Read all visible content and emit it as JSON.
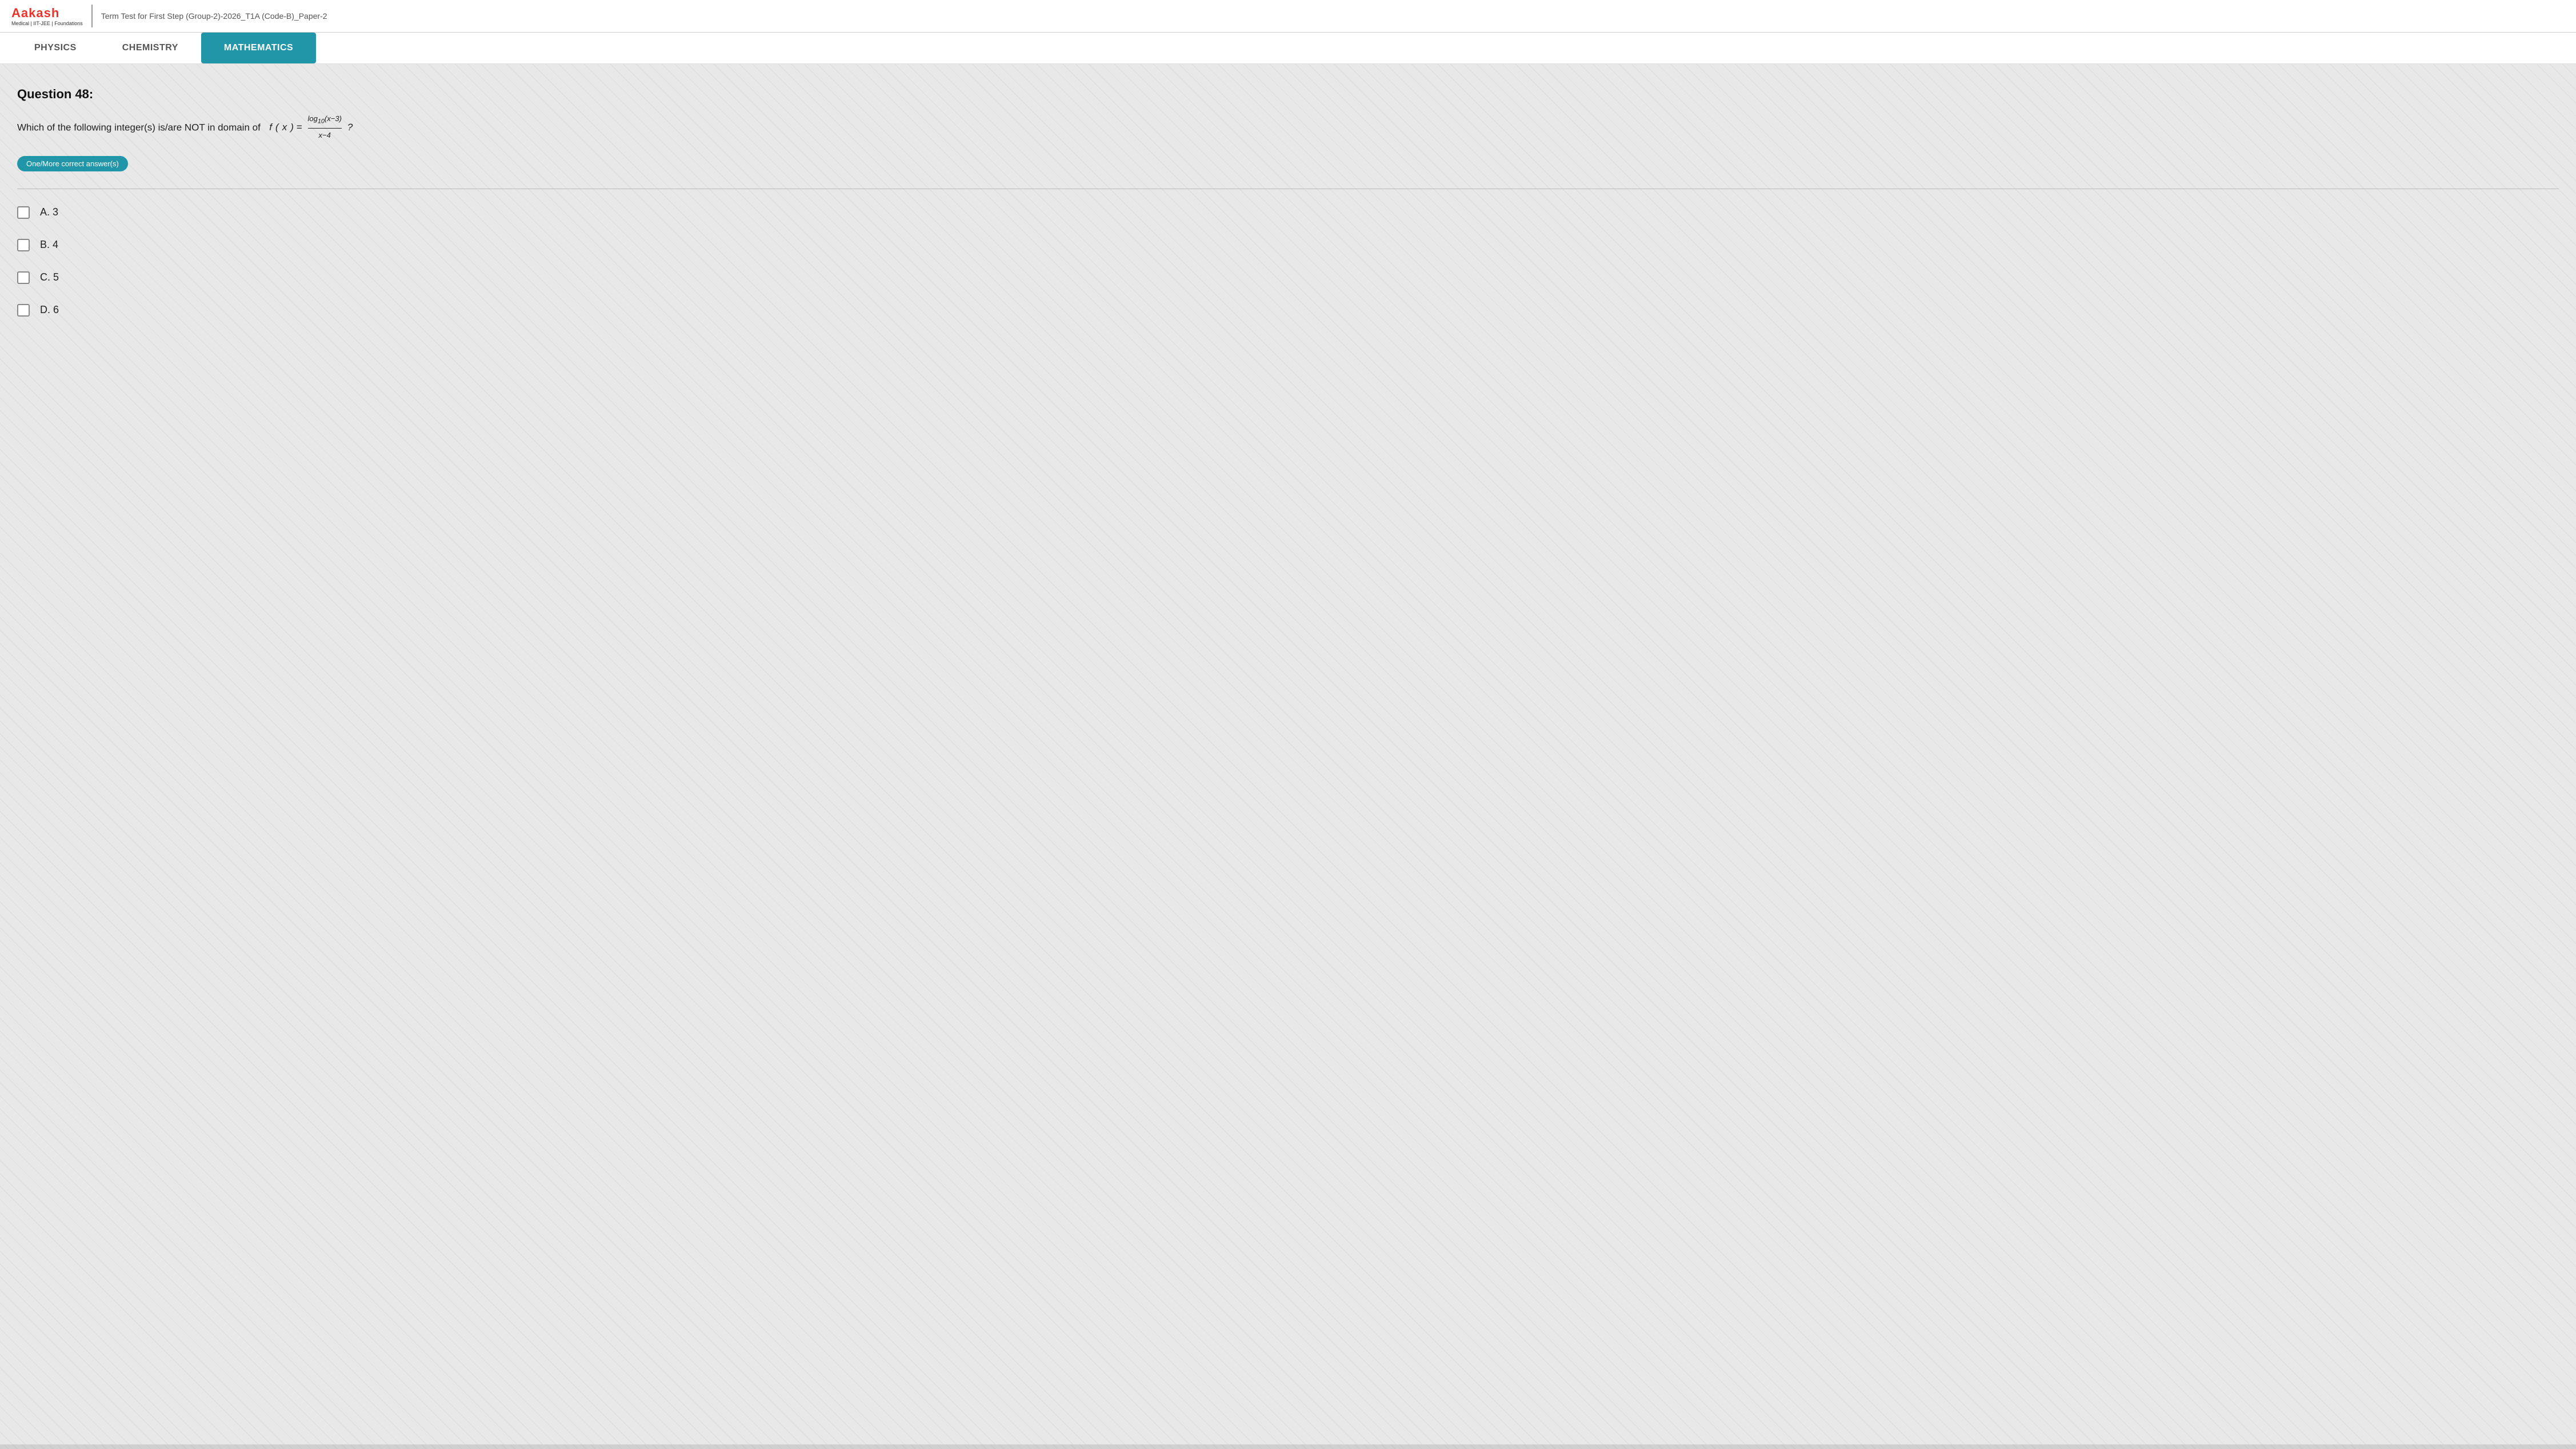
{
  "header": {
    "logo": "Aakash",
    "logo_sub": "Medical | IIT-JEE | Foundations",
    "title": "Term Test for First Step (Group-2)-2026_T1A (Code-B)_Paper-2"
  },
  "tabs": [
    {
      "id": "physics",
      "label": "PHYSICS",
      "active": false
    },
    {
      "id": "chemistry",
      "label": "CHEMISTRY",
      "active": false
    },
    {
      "id": "mathematics",
      "label": "MATHEMATICS",
      "active": true
    }
  ],
  "question": {
    "number": "Question 48:",
    "text": "Which of the following integer(s) is/are NOT in domain of",
    "formula_intro": "f(x) = log₁₀(x−3) / (x−4) ?",
    "answer_type": "One/More correct answer(s)"
  },
  "options": [
    {
      "id": "A",
      "label": "A. 3"
    },
    {
      "id": "B",
      "label": "B. 4"
    },
    {
      "id": "C",
      "label": "C. 5"
    },
    {
      "id": "D",
      "label": "D. 6"
    }
  ]
}
